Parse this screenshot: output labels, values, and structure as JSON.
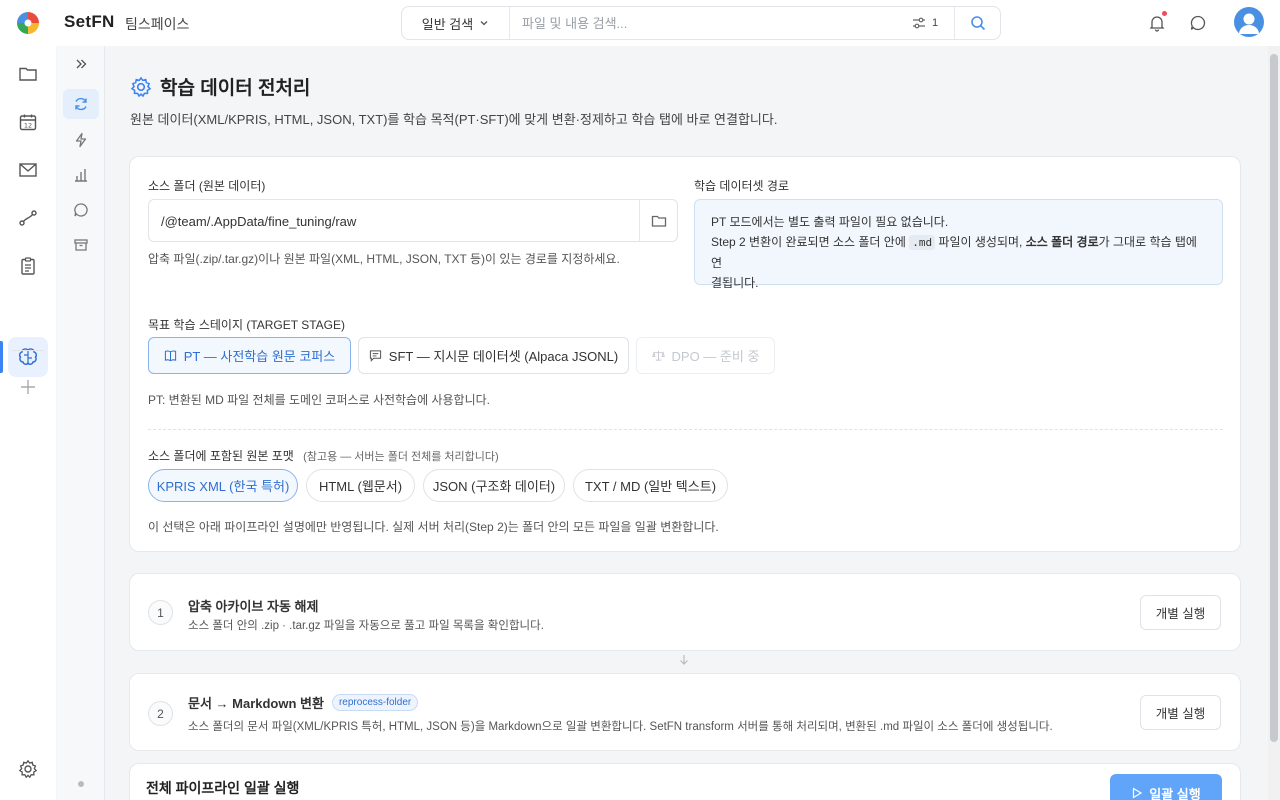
{
  "app": {
    "brand": "SetFN",
    "workspace": "팀스페이스"
  },
  "search": {
    "mode": "일반 검색",
    "placeholder": "파일 및 내용 검색...",
    "filter_count": "1"
  },
  "page": {
    "title": "학습 데이터 전처리",
    "description": "원본 데이터(XML/KPRIS, HTML, JSON, TXT)를 학습 목적(PT·SFT)에 맞게 변환·정제하고 학습 탭에 바로 연결합니다."
  },
  "source": {
    "label": "소스 폴더 (원본 데이터)",
    "value": "/@team/.AppData/fine_tuning/raw",
    "help": "압축 파일(.zip/.tar.gz)이나 원본 파일(XML, HTML, JSON, TXT 등)이 있는 경로를 지정하세요."
  },
  "dataset": {
    "label": "학습 데이터셋 경로",
    "line1": "PT 모드에서는 별도 출력 파일이 필요 없습니다.",
    "line2_a": "Step 2 변환이 완료되면 소스 폴더 안에 ",
    "line2_code": ".md",
    "line2_b": " 파일이 생성되며, ",
    "line2_bold": "소스 폴더 경로",
    "line2_c": "가 그대로 학습 탭에 연",
    "line3": "결됩니다."
  },
  "stage": {
    "label": "목표 학습 스테이지 (TARGET STAGE)",
    "options": [
      {
        "label": "PT — 사전학습 원문 코퍼스"
      },
      {
        "label": "SFT — 지시문 데이터셋 (Alpaca JSONL)"
      },
      {
        "label": "DPO — 준비 중"
      }
    ],
    "help": "PT: 변환된 MD 파일 전체를 도메인 코퍼스로 사전학습에 사용합니다."
  },
  "formats": {
    "label": "소스 폴더에 포함된 원본 포맷",
    "note": "(참고용 — 서버는 폴더 전체를 처리합니다)",
    "options": [
      "KPRIS XML (한국 특허)",
      "HTML (웹문서)",
      "JSON (구조화 데이터)",
      "TXT / MD (일반 텍스트)"
    ],
    "help": "이 선택은 아래 파이프라인 설명에만 반영됩니다. 실제 서버 처리(Step 2)는 폴더 안의 모든 파일을 일괄 변환합니다."
  },
  "steps": [
    {
      "num": "1",
      "title": "압축 아카이브 자동 해제",
      "desc": "소스 폴더 안의 .zip · .tar.gz 파일을 자동으로 풀고 파일 목록을 확인합니다.",
      "button": "개별 실행"
    },
    {
      "num": "2",
      "title": "문서 → Markdown 변환",
      "tag": "reprocess-folder",
      "desc": "소스 폴더의 문서 파일(XML/KPRIS 특허, HTML, JSON 등)을 Markdown으로 일괄 변환합니다. SetFN transform 서버를 통해 처리되며, 변환된 .md 파일이 소스 폴더에 생성됩니다.",
      "button": "개별 실행"
    }
  ],
  "pipeline": {
    "title": "전체 파이프라인 일괄 실행",
    "button": "일괄 실행"
  },
  "colors": {
    "accent": "#3b82f6",
    "primary_button": "#60a5fa",
    "active_bg": "#f3f8fe"
  }
}
